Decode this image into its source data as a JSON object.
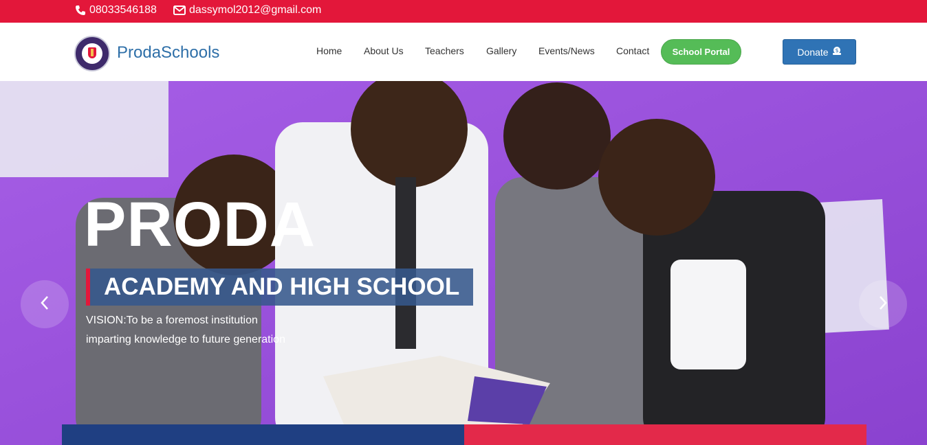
{
  "topbar": {
    "phone": "08033546188",
    "email": "dassymol2012@gmail.com"
  },
  "navbar": {
    "brand": "ProdaSchools",
    "links": [
      "Home",
      "About Us",
      "Teachers",
      "Gallery",
      "Events/News",
      "Contact"
    ],
    "portal_button": "School Portal",
    "donate_button": "Donate"
  },
  "hero": {
    "title": "PRODA",
    "subtitle": "ACADEMY AND HIGH SCHOOL",
    "vision_line1": "VISION:To be a foremost institution",
    "vision_line2": "imparting knowledge to future generation"
  },
  "colors": {
    "topbar": "#e3173a",
    "brand": "#2e6fa8",
    "portal": "#55bc57",
    "donate": "#2f73b5",
    "hero_bg": "#9b56dc"
  },
  "icons": {
    "phone": "phone-icon",
    "email": "envelope-icon",
    "donate": "donate-icon",
    "prev": "chevron-left-icon",
    "next": "chevron-right-icon"
  }
}
